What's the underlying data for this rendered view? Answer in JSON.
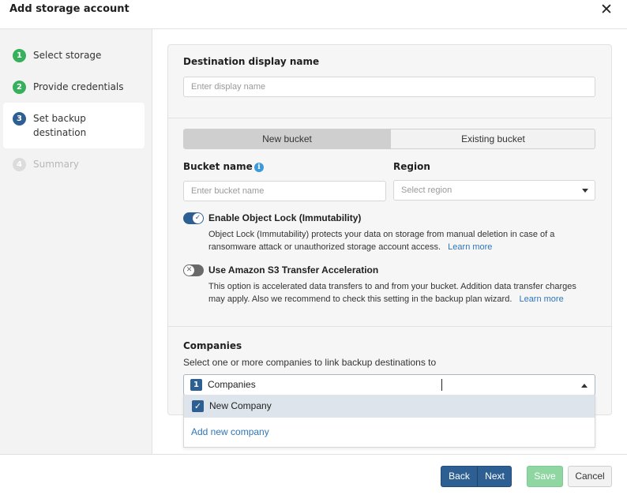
{
  "dialog": {
    "title": "Add storage account"
  },
  "steps": [
    {
      "num": "1",
      "label": "Select storage",
      "state": "done"
    },
    {
      "num": "2",
      "label": "Provide credentials",
      "state": "done"
    },
    {
      "num": "3",
      "label_line1": "Set backup",
      "label_line2": "destination",
      "state": "active"
    },
    {
      "num": "4",
      "label": "Summary",
      "state": "pending"
    }
  ],
  "destination": {
    "label": "Destination display name",
    "placeholder": "Enter display name"
  },
  "bucket_tabs": {
    "new": "New bucket",
    "existing": "Existing bucket",
    "selected": "New bucket"
  },
  "bucket": {
    "label": "Bucket name",
    "placeholder": "Enter bucket name"
  },
  "region": {
    "label": "Region",
    "placeholder": "Select region"
  },
  "object_lock": {
    "title": "Enable Object Lock (Immutability)",
    "enabled": true,
    "desc_line1": "Object Lock (Immutability) protects your data on storage from manual deletion in case of a",
    "desc_line2": "ransomware attack or unauthorized storage account access.",
    "link": "Learn more"
  },
  "transfer_accel": {
    "title": "Use Amazon S3 Transfer Acceleration",
    "enabled": false,
    "desc_line1": "This option is accelerated data transfers to and from your bucket. Addition data transfer charges",
    "desc_line2": "may apply. Also we recommend to check this setting in the backup plan wizard.",
    "link": "Learn more"
  },
  "companies": {
    "label": "Companies",
    "sub": "Select one or more companies to link backup destinations to",
    "count": "1",
    "value": "Companies",
    "options": [
      {
        "label": "New Company",
        "checked": true
      }
    ],
    "add_link": "Add new company"
  },
  "footer": {
    "back": "Back",
    "next": "Next",
    "save": "Save",
    "cancel": "Cancel"
  },
  "colors": {
    "primary": "#2d5f92",
    "success": "#36b05a",
    "save_disabled": "#8fd6a2",
    "link": "#2f76b8"
  }
}
